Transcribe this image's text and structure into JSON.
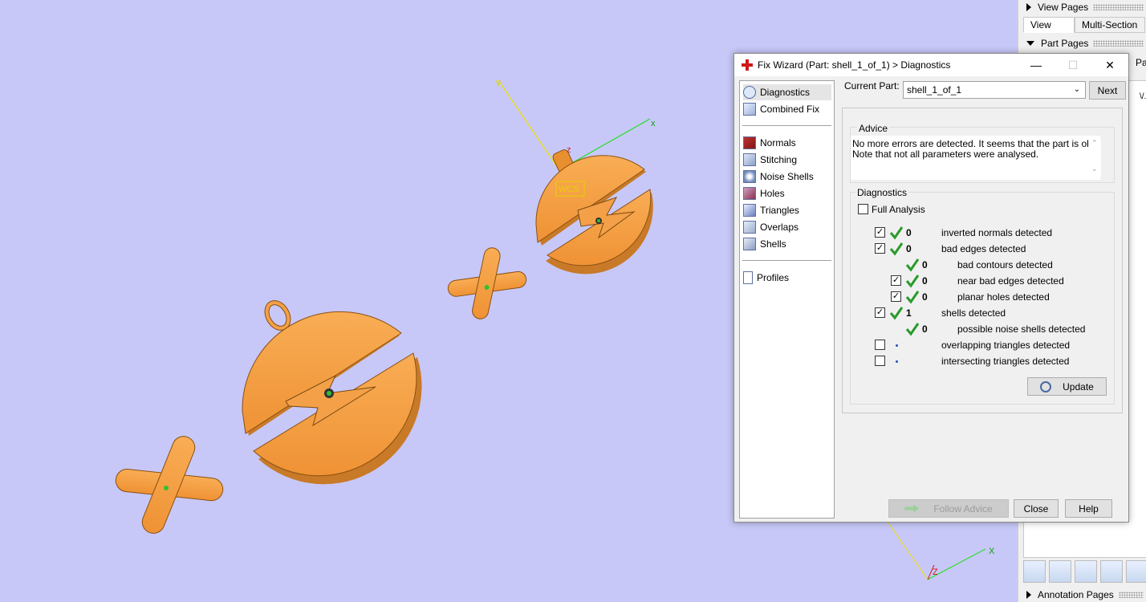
{
  "viewport": {
    "wcs_label": "WCS",
    "axes": {
      "x": "x",
      "z": "z",
      "corner_z": "Z"
    }
  },
  "side_panel": {
    "view_pages": "View Pages",
    "tabs": [
      "View",
      "Multi-Section"
    ],
    "part_pages": "Part Pages",
    "part_tab_partial": "Par",
    "annotation_pages": "Annotation Pages",
    "list_partial": "\\/..."
  },
  "dialog": {
    "title": "Fix Wizard (Part: shell_1_of_1) > Diagnostics",
    "nav": {
      "top": [
        {
          "label": "Diagnostics",
          "icon": "magnifier-icon"
        },
        {
          "label": "Combined Fix",
          "icon": "cube-icon"
        }
      ],
      "fixes": [
        {
          "label": "Normals",
          "icon": "normals-icon"
        },
        {
          "label": "Stitching",
          "icon": "stitching-icon"
        },
        {
          "label": "Noise Shells",
          "icon": "noise-shells-icon"
        },
        {
          "label": "Holes",
          "icon": "holes-icon"
        },
        {
          "label": "Triangles",
          "icon": "triangles-icon"
        },
        {
          "label": "Overlaps",
          "icon": "overlaps-icon"
        },
        {
          "label": "Shells",
          "icon": "shells-icon"
        }
      ],
      "profiles": {
        "label": "Profiles",
        "icon": "document-icon"
      }
    },
    "current_part_label": "Current Part:",
    "current_part_value": "shell_1_of_1",
    "next": "Next",
    "advice": {
      "heading": "Advice",
      "text": "No more errors are detected. It seems that the part is ok. Note that not all parameters were analysed."
    },
    "diagnostics": {
      "heading": "Diagnostics",
      "full_analysis": "Full Analysis",
      "rows": [
        {
          "checked": true,
          "status": "ok",
          "count": "0",
          "label": "inverted normals detected",
          "indent": 0
        },
        {
          "checked": true,
          "status": "ok",
          "count": "0",
          "label": "bad edges detected",
          "indent": 0
        },
        {
          "checked": null,
          "status": "ok",
          "count": "0",
          "label": "bad contours detected",
          "indent": 1
        },
        {
          "checked": true,
          "status": "ok",
          "count": "0",
          "label": "near bad edges detected",
          "indent": 1
        },
        {
          "checked": true,
          "status": "ok",
          "count": "0",
          "label": "planar holes detected",
          "indent": 1
        },
        {
          "checked": true,
          "status": "ok",
          "count": "1",
          "label": "shells detected",
          "indent": 0
        },
        {
          "checked": null,
          "status": "ok",
          "count": "0",
          "label": "possible noise shells detected",
          "indent": 1
        },
        {
          "checked": false,
          "status": "none",
          "count": "",
          "label": "overlapping triangles detected",
          "indent": 0
        },
        {
          "checked": false,
          "status": "none",
          "count": "",
          "label": "intersecting triangles detected",
          "indent": 0
        }
      ],
      "update": "Update"
    },
    "buttons": {
      "follow_advice": "Follow Advice",
      "close": "Close",
      "help": "Help"
    }
  },
  "colors": {
    "viewport_bg": "#c8c8f8",
    "part_orange": "#f7a040",
    "ok_green": "#2a9a2a"
  }
}
